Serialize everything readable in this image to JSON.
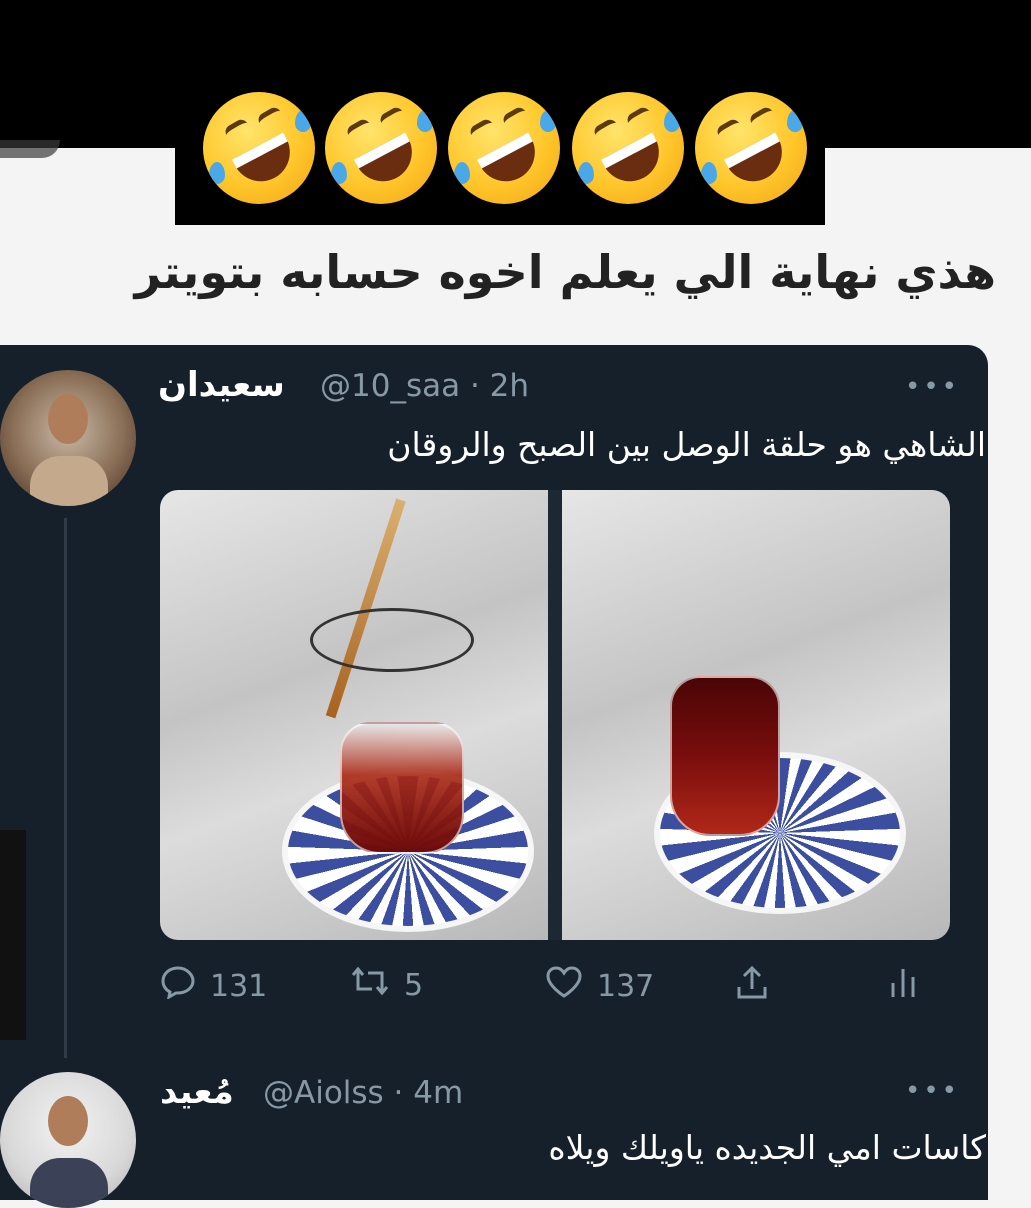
{
  "banner": {
    "emojis": [
      "rolling-on-floor-laughing",
      "rolling-on-floor-laughing",
      "rolling-on-floor-laughing",
      "rolling-on-floor-laughing",
      "rolling-on-floor-laughing"
    ],
    "caption": "هذي نهاية الي يعلم اخوه حسابه بتويتر"
  },
  "tweets": [
    {
      "name": "سعيدان",
      "handle": "@10_saa · 2h",
      "more": "•••",
      "text": "الشاهي هو حلقة الوصل بين الصبح والروقان",
      "actions": {
        "replies": "131",
        "retweets": "5",
        "likes": "137"
      }
    },
    {
      "name": "مُعيد",
      "handle": "@Aiolss · 4m",
      "more": "•••",
      "text": "كاسات امي الجديده ياويلك ويلاه"
    }
  ],
  "colors": {
    "card_bg": "#15202b",
    "muted": "#8899a6",
    "text": "#ffffff"
  }
}
